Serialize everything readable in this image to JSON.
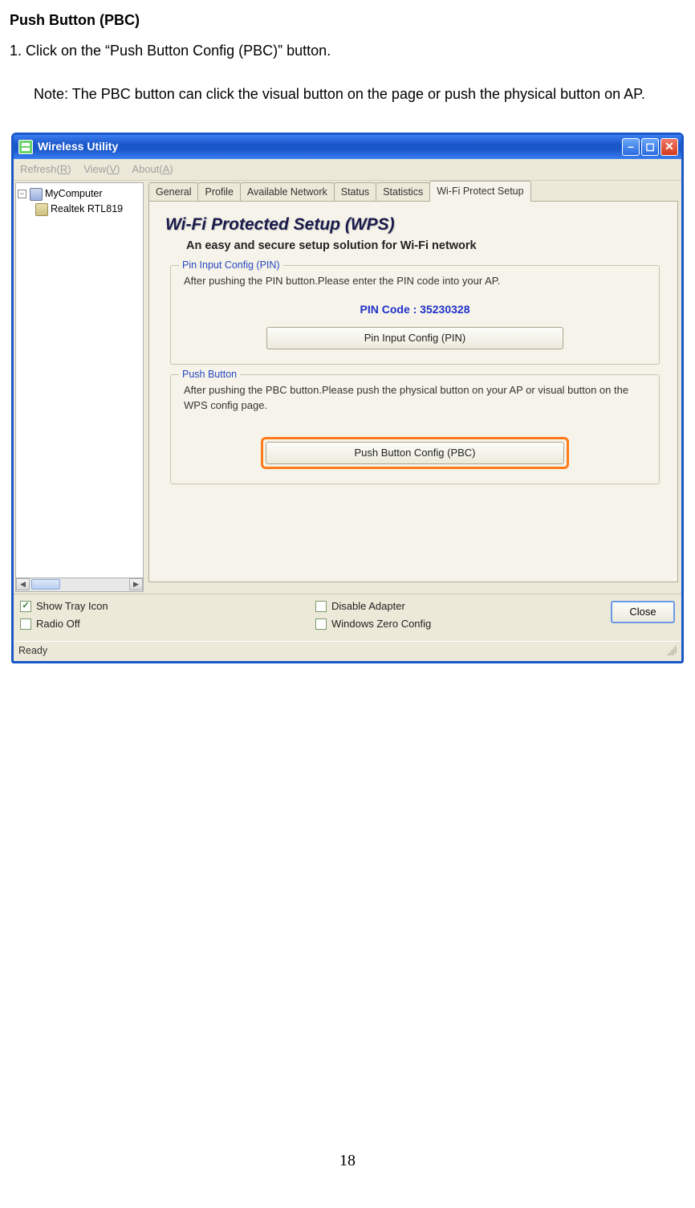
{
  "doc": {
    "heading": "Push Button (PBC)",
    "step1": "1. Click on the “Push Button Config (PBC)” button.",
    "note": "Note: The PBC button can click the visual button on the page or push the physical button on AP.",
    "page_number": "18"
  },
  "window": {
    "title": "Wireless Utility",
    "menu": {
      "refresh": "Refresh(R)",
      "view": "View(V)",
      "about": "About(A)"
    },
    "tree": {
      "root": "MyComputer",
      "adapter": "Realtek RTL819"
    },
    "tabs": {
      "general": "General",
      "profile": "Profile",
      "available_network": "Available Network",
      "status": "Status",
      "statistics": "Statistics",
      "wps": "Wi-Fi Protect Setup"
    },
    "wps": {
      "title": "Wi-Fi Protected Setup (WPS)",
      "subtitle": "An easy and secure setup solution for Wi-Fi network",
      "pin_group": {
        "legend": "Pin Input Config (PIN)",
        "desc": "After pushing the PIN button.Please enter the PIN code into your AP.",
        "pin_label": "PIN Code :  35230328",
        "button": "Pin Input Config (PIN)"
      },
      "pbc_group": {
        "legend": "Push Button",
        "desc": "After pushing the PBC button.Please push the physical button on your AP or visual button on the WPS config page.",
        "button": "Push Button Config (PBC)"
      }
    },
    "checks": {
      "show_tray": "Show Tray Icon",
      "radio_off": "Radio Off",
      "disable_adapter": "Disable Adapter",
      "win_zero": "Windows Zero Config"
    },
    "close_btn": "Close",
    "status": "Ready"
  }
}
